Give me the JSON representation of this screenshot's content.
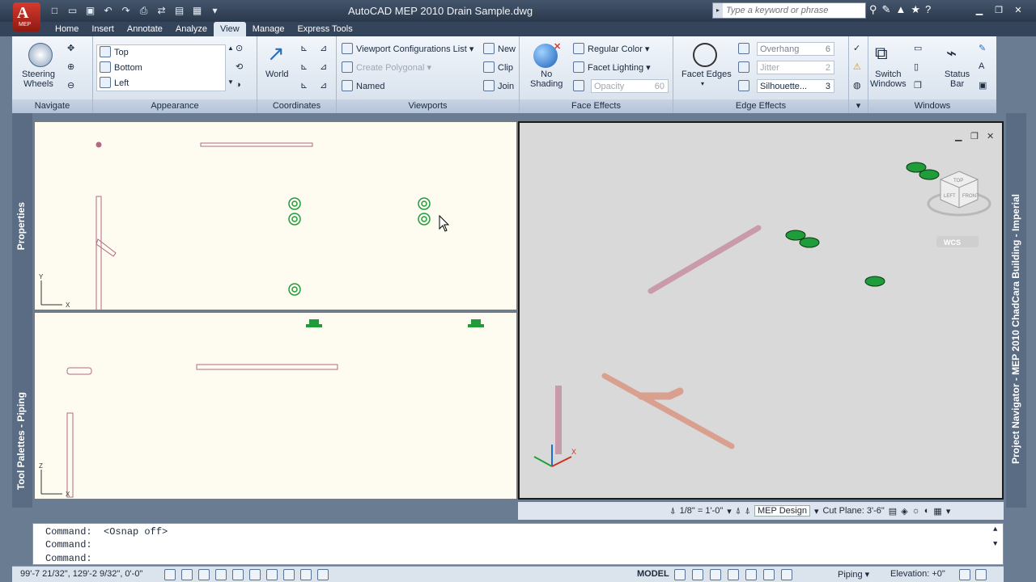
{
  "app": {
    "title": "AutoCAD MEP 2010   Drain Sample.dwg",
    "menu_label": "MEP",
    "menu_icon": "A"
  },
  "search": {
    "placeholder": "Type a keyword or phrase"
  },
  "tabs": [
    "Home",
    "Insert",
    "Annotate",
    "Analyze",
    "View",
    "Manage",
    "Express Tools"
  ],
  "active_tab": "View",
  "ribbon": {
    "navigate": {
      "title": "Navigate",
      "steering": "Steering\nWheels"
    },
    "appearance": {
      "title": "Appearance",
      "views": [
        "Top",
        "Bottom",
        "Left"
      ]
    },
    "coordinates": {
      "title": "Coordinates",
      "world": "World"
    },
    "viewports": {
      "title": "Viewports",
      "config": "Viewport Configurations List",
      "polygonal": "Create Polygonal",
      "named": "Named",
      "new": "New",
      "clip": "Clip",
      "join": "Join"
    },
    "face_effects": {
      "title": "Face Effects",
      "no_shading": "No\nShading",
      "regular_color": "Regular Color",
      "facet_lighting": "Facet Lighting",
      "opacity": "Opacity",
      "opacity_value": "60"
    },
    "edge_effects": {
      "title": "Edge Effects",
      "facet_edges": "Facet Edges",
      "overhang": "Overhang",
      "overhang_value": "6",
      "jitter": "Jitter",
      "jitter_value": "2",
      "silhouette": "Silhouette...",
      "silhouette_value": "3"
    },
    "windows": {
      "title": "Windows",
      "switch": "Switch\nWindows",
      "status": "Status\nBar"
    }
  },
  "side": {
    "properties": "Properties",
    "tool_palettes": "Tool Palettes - Piping",
    "project_navigator": "Project Navigator - MEP 2010 ChadCara Building - Imperial"
  },
  "viewcube": {
    "top": "TOP",
    "left": "LEFT",
    "front": "FRONT",
    "wcs": "WCS"
  },
  "axes": {
    "x": "X",
    "y": "Y",
    "z": "Z"
  },
  "vp_status": {
    "scale": "1/8\" = 1'-0\"",
    "config": "MEP Design",
    "cut_plane": "Cut Plane: 3'-6\""
  },
  "command": {
    "lines": [
      "Command:  <Osnap off>",
      "Command:",
      "Command:"
    ]
  },
  "status": {
    "coords": "99'-7 21/32\", 129'-2 9/32\", 0'-0\"",
    "model": "MODEL",
    "piping": "Piping",
    "elevation": "Elevation: +0\""
  },
  "colors": {
    "pipe": "#c99aa9",
    "fitting": "#1f9d3a",
    "accent": "#d63a2e"
  }
}
